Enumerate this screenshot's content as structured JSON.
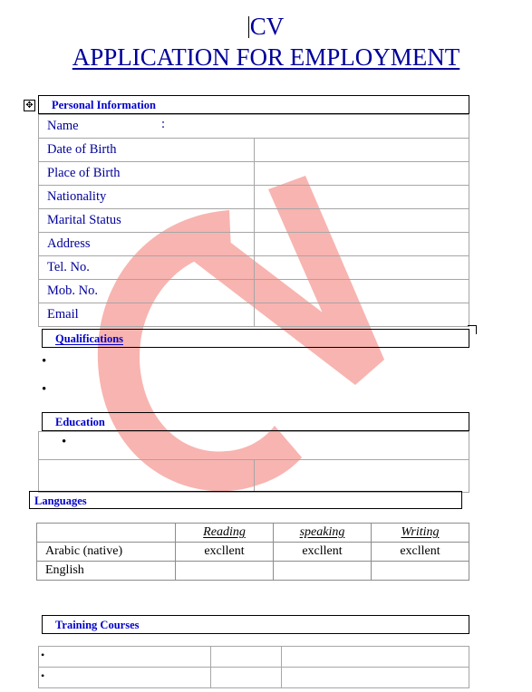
{
  "document": {
    "title_cv": "CV",
    "title_main": "APPLICATION FOR EMPLOYMENT",
    "watermark_text": "CV",
    "colors": {
      "heading_blue": "#00009B",
      "section_blue": "#0000CC",
      "watermark_pink": "#F8B4B0",
      "table_border": "#A6A6A6",
      "box_border": "#000000"
    }
  },
  "table_handle": {
    "icon": "move-handle-icon",
    "glyph": "✥"
  },
  "sections": {
    "personal_information": {
      "heading": "Personal Information",
      "underlined": false,
      "rows": [
        {
          "label": "Name",
          "colon": ":",
          "value": "",
          "full_width": true
        },
        {
          "label": "Date of Birth",
          "value": ""
        },
        {
          "label": "Place of Birth",
          "value": ""
        },
        {
          "label": "Nationality",
          "value": ""
        },
        {
          "label": "Marital Status",
          "value": ""
        },
        {
          "label": "Address",
          "value": ""
        },
        {
          "label": "Tel. No.",
          "value": ""
        },
        {
          "label": "Mob. No.",
          "value": ""
        },
        {
          "label": "Email",
          "value": ""
        }
      ]
    },
    "qualifications": {
      "heading": "Qualifications",
      "underlined": true,
      "bullets": [
        "",
        ""
      ]
    },
    "education": {
      "heading": "Education",
      "underlined": false,
      "bullets": [
        ""
      ],
      "sub_rows": [
        {
          "col1": "",
          "col2": ""
        }
      ]
    },
    "languages": {
      "heading": "Languages",
      "underlined": false,
      "columns": [
        "",
        "Reading",
        "speaking",
        "Writing"
      ],
      "rows": [
        {
          "language": "Arabic (native)",
          "reading": "excllent",
          "speaking": "excllent",
          "writing": "excllent"
        },
        {
          "language": "English",
          "reading": "",
          "speaking": "",
          "writing": ""
        }
      ]
    },
    "training_courses": {
      "heading": "Training Courses",
      "underlined": false,
      "rows": [
        {
          "bullet": "•",
          "col1": "",
          "col2": "",
          "col3": ""
        },
        {
          "bullet": "•",
          "col1": "",
          "col2": "",
          "col3": ""
        }
      ]
    }
  }
}
